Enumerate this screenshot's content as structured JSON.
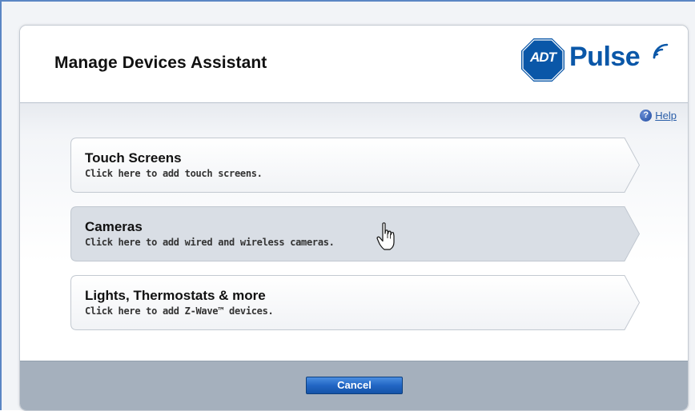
{
  "dialog": {
    "title": "Manage Devices Assistant"
  },
  "logo": {
    "badge_text": "ADT",
    "word": "Pulse",
    "brand_color": "#0a57a8"
  },
  "help": {
    "label": "Help",
    "icon": "question-icon"
  },
  "options": [
    {
      "title": "Touch Screens",
      "subtitle": "Click here to add touch screens.",
      "hovered": false
    },
    {
      "title": "Cameras",
      "subtitle": "Click here to add wired and wireless cameras.",
      "hovered": true
    },
    {
      "title": "Lights, Thermostats & more",
      "subtitle": "Click here to add Z-Wave™ devices.",
      "hovered": false
    }
  ],
  "footer": {
    "cancel_label": "Cancel"
  },
  "colors": {
    "accent": "#2266c4",
    "footer": "#a5b0bd",
    "hover": "#d9dee5"
  }
}
